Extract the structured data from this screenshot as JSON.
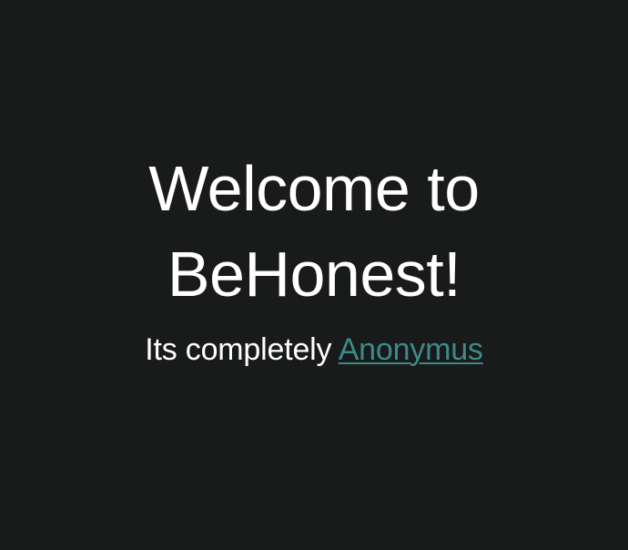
{
  "hero": {
    "title_line1": "Welcome to",
    "title_line2": "BeHonest!",
    "tagline_prefix": "Its completely ",
    "tagline_link": "Anonymus"
  },
  "colors": {
    "background": "#191a1a",
    "text": "#ffffff",
    "link": "#3d8a8a"
  }
}
